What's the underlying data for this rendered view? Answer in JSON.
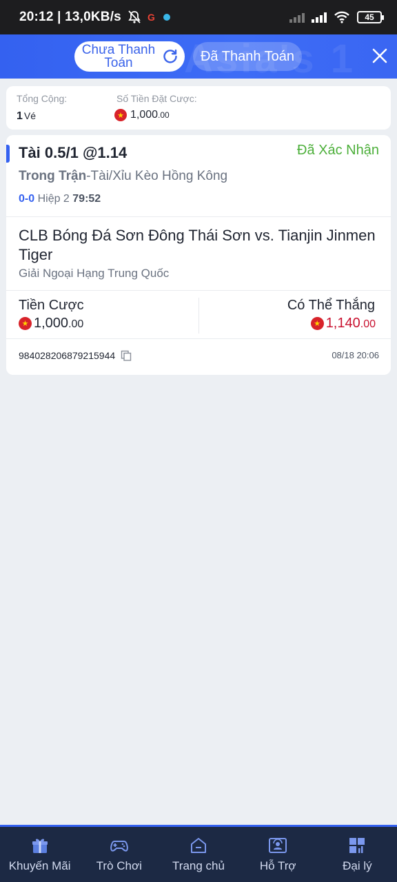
{
  "status_bar": {
    "time_speed": "20:12 | 13,0KB/s",
    "battery": "45"
  },
  "header": {
    "watermark": "Asia's 1",
    "tab_unpaid_label": "Chưa Thanh Toán",
    "tab_paid_label": "Đã Thanh Toán"
  },
  "summary": {
    "total_caption": "Tổng Cộng:",
    "total_count": "1",
    "total_unit": "Vé",
    "stake_caption": "Số Tiền Đặt Cược:",
    "stake_int": "1,000",
    "stake_dec": ".00"
  },
  "bet": {
    "title": "Tài 0.5/1 @1.14",
    "status": "Đã Xác Nhận",
    "market_live": "Trong Trận",
    "market_name": "-Tài/Xỉu Kèo Hồng Kông",
    "score": "0-0",
    "period": "Hiệp 2",
    "clock": "79:52",
    "match": "CLB Bóng Đá Sơn Đông Thái Sơn vs. Tianjin Jinmen Tiger",
    "league": "Giải Ngoại Hạng Trung Quốc",
    "stake_label": "Tiền Cược",
    "stake_int": "1,000",
    "stake_dec": ".00",
    "win_label": "Có Thể Thắng",
    "win_int": "1,140",
    "win_dec": ".00",
    "ticket_id": "984028206879215944",
    "ticket_time": "08/18 20:06"
  },
  "colors": {
    "primary": "#3461f0",
    "confirmed": "#4caf3a",
    "win": "#c8102e",
    "nav_bg": "#1c2944"
  },
  "nav": [
    {
      "label": "Khuyến Mãi",
      "icon": "gift-icon"
    },
    {
      "label": "Trò Chơi",
      "icon": "gamepad-icon"
    },
    {
      "label": "Trang chủ",
      "icon": "home-icon"
    },
    {
      "label": "Hỗ Trợ",
      "icon": "support-icon"
    },
    {
      "label": "Đại lý",
      "icon": "agent-icon"
    }
  ]
}
